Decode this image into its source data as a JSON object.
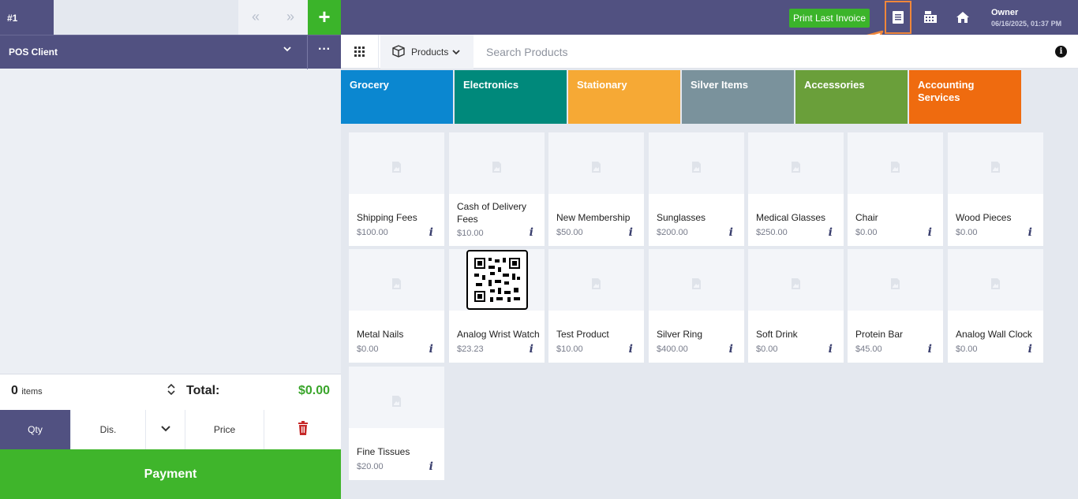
{
  "order": {
    "tab_number": "#1",
    "client": "POS Client"
  },
  "totals": {
    "items_count": "0",
    "items_label": "items",
    "total_label": "Total:",
    "total_value": "$0.00"
  },
  "actions": {
    "qty": "Qty",
    "discount": "Dis.",
    "price": "Price",
    "payment": "Payment"
  },
  "header": {
    "print_last_invoice": "Print Last Invoice",
    "user_name": "Owner",
    "datetime": "06/16/2025, 01:37 PM"
  },
  "toolbar": {
    "products_dropdown": "Products",
    "search_placeholder": "Search Products"
  },
  "categories": [
    {
      "name": "Grocery",
      "color": "#0b87d0"
    },
    {
      "name": "Electronics",
      "color": "#00897b"
    },
    {
      "name": "Stationary",
      "color": "#f6a935"
    },
    {
      "name": "Silver Items",
      "color": "#7a929c"
    },
    {
      "name": "Accessories",
      "color": "#6a9f3a"
    },
    {
      "name": "Accounting Services",
      "color": "#ef6b0f"
    }
  ],
  "products": [
    {
      "name": "Shipping Fees",
      "price": "$100.00"
    },
    {
      "name": "Cash of Delivery Fees",
      "price": "$10.00"
    },
    {
      "name": "New Membership",
      "price": "$50.00"
    },
    {
      "name": "Sunglasses",
      "price": "$200.00"
    },
    {
      "name": "Medical Glasses",
      "price": "$250.00"
    },
    {
      "name": "Chair",
      "price": "$0.00"
    },
    {
      "name": "Wood Pieces",
      "price": "$0.00"
    },
    {
      "name": "Metal Nails",
      "price": "$0.00"
    },
    {
      "name": "Analog Wrist Watch",
      "price": "$23.23"
    },
    {
      "name": "Test Product",
      "price": "$10.00"
    },
    {
      "name": "Silver Ring",
      "price": "$400.00"
    },
    {
      "name": "Soft Drink",
      "price": "$0.00"
    },
    {
      "name": "Protein Bar",
      "price": "$45.00"
    },
    {
      "name": "Analog Wall Clock",
      "price": "$0.00"
    },
    {
      "name": "Fine Tissues",
      "price": "$20.00"
    }
  ],
  "icons": {
    "prev": "chevron-double-left-icon",
    "next": "chevron-double-right-icon",
    "add": "plus-icon",
    "orders": "receipt-list-icon",
    "register": "cash-register-icon",
    "home": "home-icon",
    "info": "info-icon",
    "grid": "grid-icon",
    "delete": "trash-icon"
  }
}
